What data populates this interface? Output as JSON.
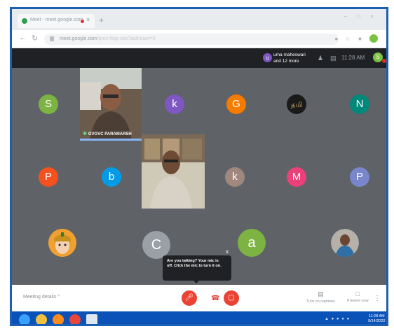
{
  "browser": {
    "tab_title": "Meet - meet.google.com",
    "tab_close": "×",
    "new_tab": "+",
    "window_controls": "– □ ×",
    "url_host": "meet.google.com",
    "url_path": "/pmx-hnjs-sxe?authuser=0",
    "addr_icons": "● ☆ ★",
    "profile_initial": "S"
  },
  "meet_header": {
    "viewer_initial": "u",
    "viewer_line1": "uma maheswari",
    "viewer_line2": "and 12 more",
    "people_icon_label": "13",
    "time": "11:28 AM",
    "self_initial": "S"
  },
  "participants": [
    {
      "letter": "S",
      "color": "#7cb342"
    },
    {
      "letter": "k",
      "color": "#7e57c2"
    },
    {
      "letter": "G",
      "color": "#f57c00"
    },
    {
      "letter": "N",
      "color": "#00897b"
    },
    {
      "letter": "P",
      "color": "#f4511e"
    },
    {
      "letter": "b",
      "color": "#039be5"
    },
    {
      "letter": "k",
      "color": "#a1887f"
    },
    {
      "letter": "M",
      "color": "#ec407a"
    },
    {
      "letter": "P",
      "color": "#7986cb"
    },
    {
      "letter": "C",
      "color": "#9aa0a6"
    },
    {
      "letter": "a",
      "color": "#7cb342"
    }
  ],
  "logo_text": "தமி",
  "video_tiles": {
    "pinned_name": "GVGVC PARAMARSH"
  },
  "mic_tooltip": {
    "text": "Are you talking? Your mic is off. Click the mic to turn it on.",
    "close": "x"
  },
  "controls": {
    "meeting_details": "Meeting details",
    "meeting_details_chevron": "^",
    "mic_icon": "mic-off",
    "cam_icon": "camera-off",
    "captions_label": "Turn on captions",
    "present_label": "Present now",
    "more_icon": "⋮"
  },
  "taskbar": {
    "tray": "▲ ● ● ● ●",
    "time": "11:28 AM",
    "date": "9/14/2020"
  }
}
